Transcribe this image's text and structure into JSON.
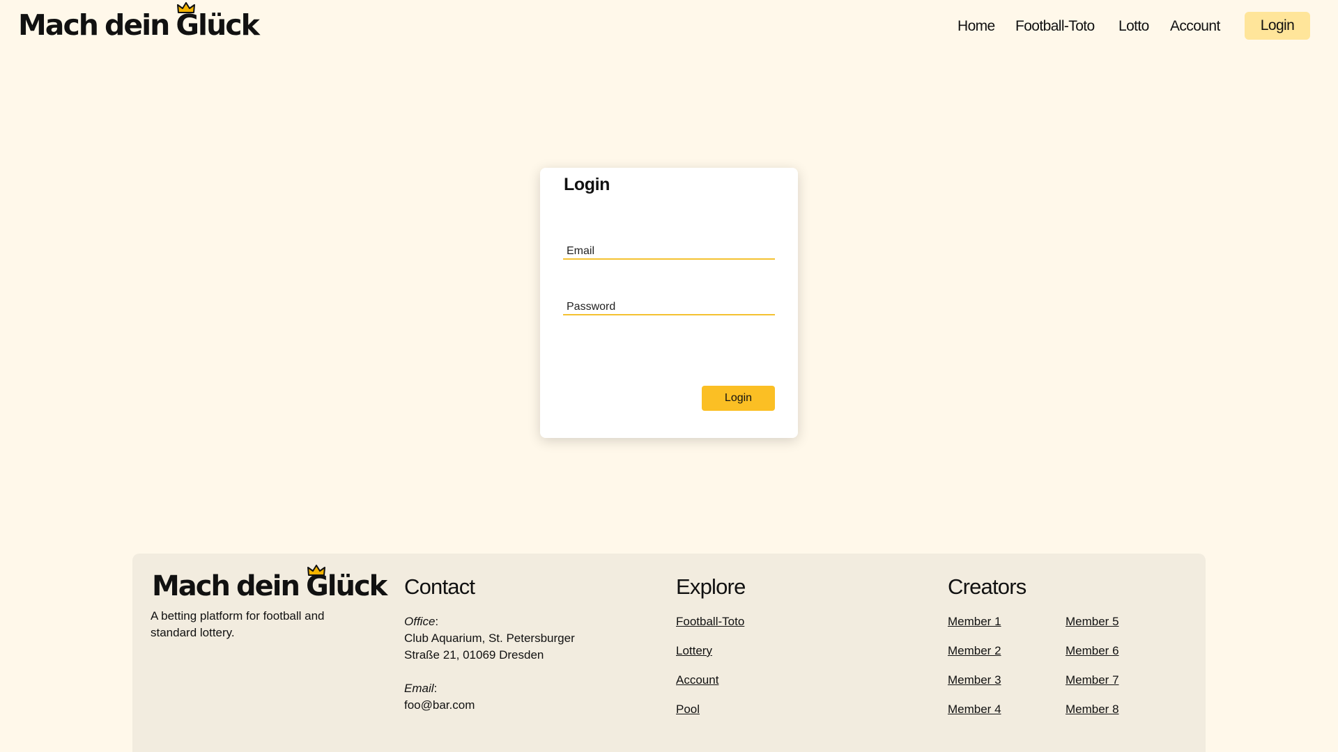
{
  "brand": {
    "name_part1": "Mach",
    "name_part2": "dein",
    "name_part3_first": "G",
    "name_part3_rest": "lück",
    "accent_color": "#f4b400",
    "background": "#fff8ea",
    "crown_icon": "crown-icon"
  },
  "nav": {
    "items": [
      "Home",
      "Football-Toto",
      "Lotto",
      "Account"
    ],
    "login_label": "Login"
  },
  "login_card": {
    "title": "Login",
    "email_placeholder": "Email",
    "password_placeholder": "Password",
    "submit_label": "Login"
  },
  "footer": {
    "tagline": "A betting platform for football and standard lottery.",
    "contact": {
      "heading": "Contact",
      "office_label": "Office",
      "office_address_line1": "Club Aquarium, St. Petersburger",
      "office_address_line2": "Straße 21, 01069 Dresden",
      "email_label": "Email",
      "email_value": "foo@bar.com"
    },
    "explore": {
      "heading": "Explore",
      "links": [
        "Football-Toto",
        "Lottery",
        "Account",
        "Pool"
      ]
    },
    "creators": {
      "heading": "Creators",
      "members": [
        "Member 1",
        "Member 2",
        "Member 3",
        "Member 4",
        "Member 5",
        "Member 6",
        "Member 7",
        "Member 8"
      ]
    }
  }
}
